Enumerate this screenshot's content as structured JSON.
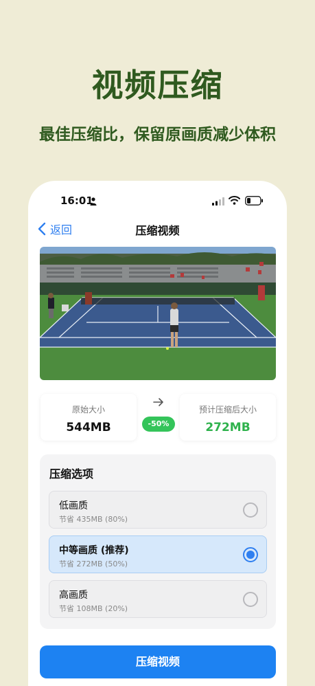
{
  "hero": {
    "title": "视频压缩",
    "subtitle": "最佳压缩比，保留原画质减少体积"
  },
  "status_bar": {
    "time": "16:01"
  },
  "nav": {
    "back_label": "返回",
    "title": "压缩视频"
  },
  "sizes": {
    "original_label": "原始大小",
    "original_value": "544MB",
    "estimated_label": "预计压缩后大小",
    "estimated_value": "272MB",
    "reduction_badge": "-50%"
  },
  "options": {
    "title": "压缩选项",
    "items": [
      {
        "name": "低画质",
        "detail": "节省 435MB (80%)",
        "selected": false
      },
      {
        "name": "中等画质 (推荐)",
        "detail": "节省 272MB (50%)",
        "selected": true
      },
      {
        "name": "高画质",
        "detail": "节省 108MB (20%)",
        "selected": false
      }
    ]
  },
  "action": {
    "compress_label": "压缩视频"
  },
  "colors": {
    "background": "#efecd6",
    "hero_text": "#2f5a1f",
    "accent_blue": "#1d82f2",
    "badge_green": "#34c45a"
  }
}
